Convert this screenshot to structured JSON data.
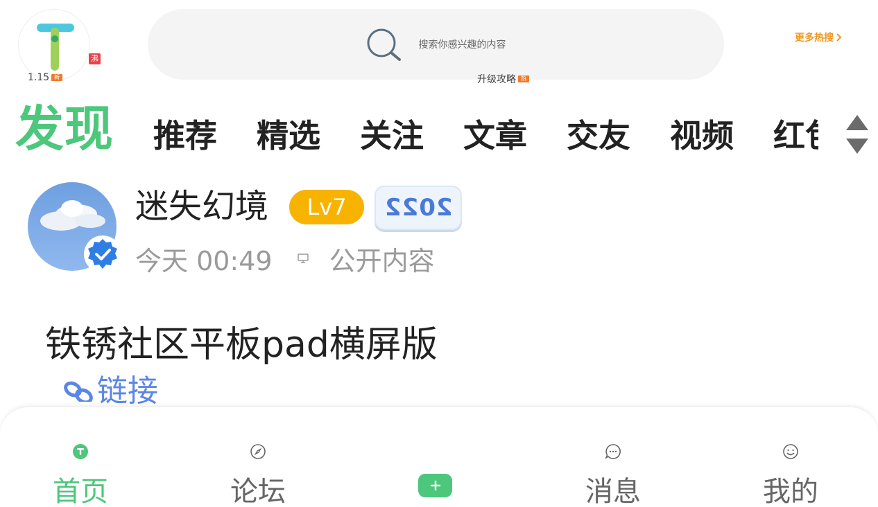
{
  "header": {
    "logo_badge": "沸",
    "logo_caption": "1.15",
    "logo_caption_badge": "新",
    "search_placeholder": "搜索你感兴趣的内容",
    "search_caption": "升级攻略",
    "search_caption_badge": "热",
    "more_hot_label": "更多热搜"
  },
  "tabs": {
    "section_title": "发现",
    "items": [
      "推荐",
      "精选",
      "关注",
      "文章",
      "交友",
      "视频",
      "红包"
    ]
  },
  "post": {
    "username": "迷失幻境",
    "level": "Lv7",
    "year_badge": "2022",
    "time": "今天 00:49",
    "visibility": "公开内容",
    "title": "铁锈社区平板pad横屏版",
    "link_label": "链接"
  },
  "bottom_nav": {
    "home": "首页",
    "forum": "论坛",
    "messages": "消息",
    "mine": "我的"
  },
  "colors": {
    "accent_green": "#4cc77b",
    "level_gold": "#f7b300",
    "hot_orange": "#f0961e",
    "link_blue": "#5b86e5"
  }
}
